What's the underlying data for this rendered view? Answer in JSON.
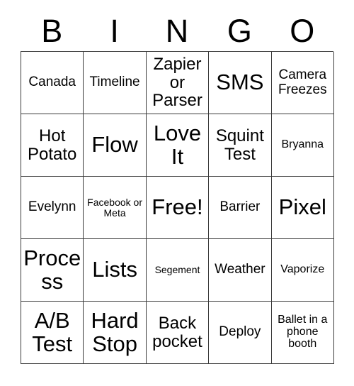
{
  "card": {
    "header": {
      "letters": [
        "B",
        "I",
        "N",
        "G",
        "O"
      ]
    },
    "rows": [
      [
        {
          "text": "Canada",
          "size": "fs-m"
        },
        {
          "text": "Timeline",
          "size": "fs-m"
        },
        {
          "text": "Zapier or Parser",
          "size": "fs-l"
        },
        {
          "text": "SMS",
          "size": "fs-xxl"
        },
        {
          "text": "Camera Freezes",
          "size": "fs-m"
        }
      ],
      [
        {
          "text": "Hot Potato",
          "size": "fs-l"
        },
        {
          "text": "Flow",
          "size": "fs-xxl"
        },
        {
          "text": "Love It",
          "size": "fs-xxl"
        },
        {
          "text": "Squint Test",
          "size": "fs-l"
        },
        {
          "text": "Bryanna",
          "size": "fs-s"
        }
      ],
      [
        {
          "text": "Evelynn",
          "size": "fs-m"
        },
        {
          "text": "Facebook or Meta",
          "size": "fs-xs"
        },
        {
          "text": "Free!",
          "size": "fs-xxl"
        },
        {
          "text": "Barrier",
          "size": "fs-m"
        },
        {
          "text": "Pixel",
          "size": "fs-xxl"
        }
      ],
      [
        {
          "text": "Process",
          "size": "fs-xxl"
        },
        {
          "text": "Lists",
          "size": "fs-xxl"
        },
        {
          "text": "Segement",
          "size": "fs-xs"
        },
        {
          "text": "Weather",
          "size": "fs-m"
        },
        {
          "text": "Vaporize",
          "size": "fs-s"
        }
      ],
      [
        {
          "text": "A/B Test",
          "size": "fs-xxl"
        },
        {
          "text": "Hard Stop",
          "size": "fs-xxl"
        },
        {
          "text": "Back pocket",
          "size": "fs-l"
        },
        {
          "text": "Deploy",
          "size": "fs-m"
        },
        {
          "text": "Ballet in a phone booth",
          "size": "fs-s"
        }
      ]
    ],
    "colors": {
      "background": "#ffffff",
      "text": "#000000",
      "border": "#3a3a3a"
    }
  }
}
